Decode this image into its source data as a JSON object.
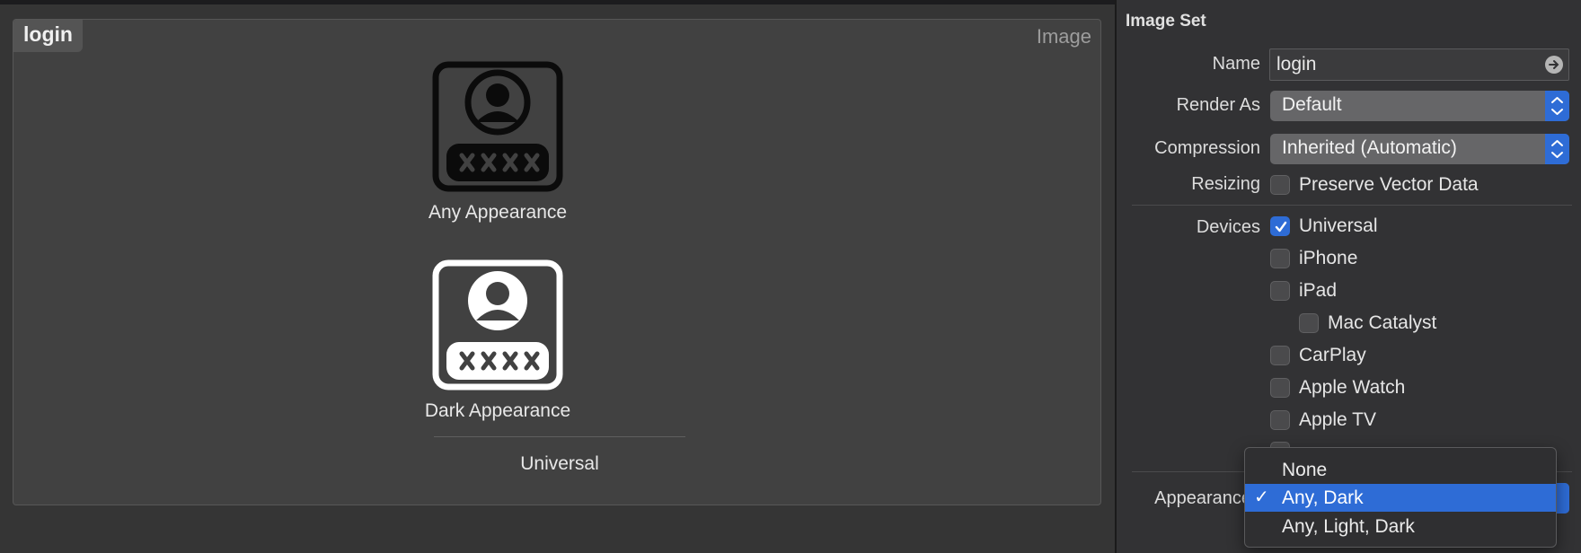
{
  "canvas": {
    "set_name": "login",
    "set_kind": "Image",
    "wells": [
      {
        "label": "Any Appearance",
        "icon": "login-icon-dark"
      },
      {
        "label": "Dark Appearance",
        "icon": "login-icon-light"
      }
    ],
    "device_label": "Universal"
  },
  "inspector": {
    "title": "Image Set",
    "name_label": "Name",
    "name_value": "login",
    "render_as_label": "Render As",
    "render_as_value": "Default",
    "compression_label": "Compression",
    "compression_value": "Inherited (Automatic)",
    "resizing_label": "Resizing",
    "preserve_vector_label": "Preserve Vector Data",
    "devices_label": "Devices",
    "devices": [
      {
        "label": "Universal",
        "checked": true
      },
      {
        "label": "iPhone",
        "checked": false
      },
      {
        "label": "iPad",
        "checked": false
      },
      {
        "label": "Mac Catalyst",
        "checked": false
      },
      {
        "label": "CarPlay",
        "checked": false
      },
      {
        "label": "Apple Watch",
        "checked": false
      },
      {
        "label": "Apple TV",
        "checked": false
      }
    ],
    "appearances_label": "Appearances"
  },
  "appearance_menu": {
    "options": [
      "None",
      "Any, Dark",
      "Any, Light, Dark"
    ],
    "selected": "Any, Dark"
  },
  "colors": {
    "accent": "#2e6cd6",
    "background": "#353535",
    "panel": "#414141"
  }
}
